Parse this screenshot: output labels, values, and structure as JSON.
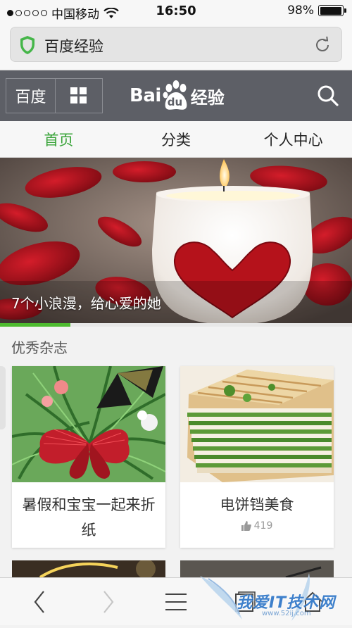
{
  "status_bar": {
    "carrier": "中国移动",
    "time": "16:50",
    "battery": "98%",
    "battery_level": 0.98
  },
  "url_bar": {
    "url_text": "百度经验",
    "icon": "shield-icon",
    "reload_icon": "reload-icon"
  },
  "top_nav": {
    "baidu_label": "百度",
    "grid_icon": "grid-icon",
    "logo_bai": "Bai",
    "logo_du": "du",
    "logo_jy": "经验",
    "search_icon": "search-icon"
  },
  "tabs": [
    {
      "label": "首页",
      "active": true
    },
    {
      "label": "分类",
      "active": false
    },
    {
      "label": "个人中心",
      "active": false
    }
  ],
  "banner": {
    "caption": "7个小浪漫，给心爱的她",
    "carousel_progress": 0.2
  },
  "section": {
    "title": "优秀杂志"
  },
  "cards": [
    {
      "title": "暑假和宝宝一起来折纸",
      "likes": ""
    },
    {
      "title": "电饼铛美食",
      "likes": "419"
    }
  ],
  "toolbar": {
    "back": "back-icon",
    "forward": "forward-icon",
    "menu": "menu-icon",
    "tabs": "tabs-icon",
    "home": "home-icon"
  },
  "watermark": {
    "text": "我爱IT技术网",
    "url": "www.52ij.com"
  },
  "colors": {
    "accent_green": "#3aa43a",
    "nav_bg": "#5d5f66",
    "progress_green": "#4dbb2f"
  }
}
